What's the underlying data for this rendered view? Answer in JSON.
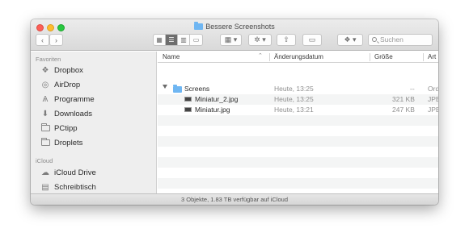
{
  "window": {
    "title": "Bessere Screenshots",
    "status": "3 Objekte, 1.83 TB verfügbar auf iCloud"
  },
  "toolbar": {
    "back_icon": "chevron-left-icon",
    "forward_icon": "chevron-right-icon",
    "view_modes": [
      "icon-view",
      "list-view",
      "column-view",
      "gallery-view"
    ],
    "active_view": "list-view",
    "group_icon": "group-icon",
    "action_icon": "gear-icon",
    "share_icon": "share-icon",
    "tag_icon": "tag-icon",
    "dropbox_icon": "dropbox-icon",
    "search_placeholder": "Suchen"
  },
  "sidebar": {
    "favorites_heading": "Favoriten",
    "favorites": [
      {
        "label": "Dropbox",
        "icon": "dropbox-icon"
      },
      {
        "label": "AirDrop",
        "icon": "airdrop-icon"
      },
      {
        "label": "Programme",
        "icon": "applications-icon"
      },
      {
        "label": "Downloads",
        "icon": "downloads-icon"
      },
      {
        "label": "PCtipp",
        "icon": "folder-icon"
      },
      {
        "label": "Droplets",
        "icon": "folder-icon"
      }
    ],
    "icloud_heading": "iCloud",
    "icloud": [
      {
        "label": "iCloud Drive",
        "icon": "cloud-icon"
      },
      {
        "label": "Schreibtisch",
        "icon": "desktop-icon"
      }
    ]
  },
  "filelist": {
    "columns": {
      "name": "Name",
      "date": "Änderungsdatum",
      "size": "Größe",
      "kind": "Art"
    },
    "rows": [
      {
        "name": "Screens",
        "date": "Heute, 13:25",
        "size": "--",
        "kind": "Ord"
      },
      {
        "name": "Miniatur_2.jpg",
        "date": "Heute, 13:25",
        "size": "321 KB",
        "kind": "JPE"
      },
      {
        "name": "Miniatur.jpg",
        "date": "Heute, 13:21",
        "size": "247 KB",
        "kind": "JPE"
      }
    ]
  },
  "colors": {
    "accent": "#6fb6f2",
    "close": "#fc5f57",
    "minimize": "#fdbc2e",
    "maximize": "#28c840"
  }
}
